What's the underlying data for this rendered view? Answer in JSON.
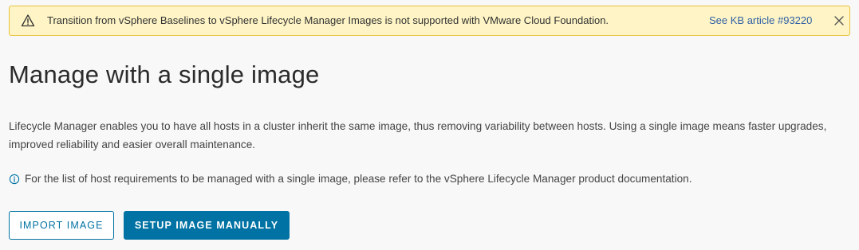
{
  "alert": {
    "icon": "warning-icon",
    "message": "Transition from vSphere Baselines to vSphere Lifecycle Manager Images is not supported with VMware Cloud Foundation.",
    "link_text": "See KB article #93220",
    "close_icon": "close-icon",
    "background_color": "#fef4c5",
    "border_color": "#e9c13b",
    "link_color": "#2f5fa6"
  },
  "main": {
    "title": "Manage with a single image",
    "description": "Lifecycle Manager enables you to have all hosts in a cluster inherit the same image, thus removing variability between hosts. Using a single image means faster upgrades, improved reliability and easier overall maintenance.",
    "info_icon": "info-icon",
    "info_text": "For the list of host requirements to be managed with a single image, please refer to the vSphere Lifecycle Manager product documentation."
  },
  "actions": {
    "import_label": "IMPORT IMAGE",
    "setup_label": "SETUP IMAGE MANUALLY",
    "accent_color": "#0072a3"
  }
}
